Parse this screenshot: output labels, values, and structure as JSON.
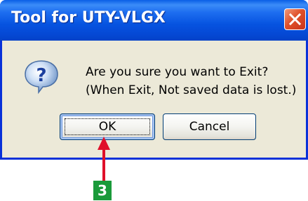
{
  "window": {
    "title": "Tool for UTY-VLGX"
  },
  "dialog": {
    "icon": "question-icon",
    "message_line1": "Are you sure you want to Exit?",
    "message_line2": "(When Exit, Not saved data is lost.)",
    "ok_label": "OK",
    "cancel_label": "Cancel"
  },
  "annotation": {
    "step_number": "3",
    "arrow_color": "#e0102a",
    "badge_color": "#1a9a3a"
  },
  "colors": {
    "titlebar": "#0653e0",
    "dialog_face": "#ece9d8",
    "close_button": "#e0512a"
  }
}
